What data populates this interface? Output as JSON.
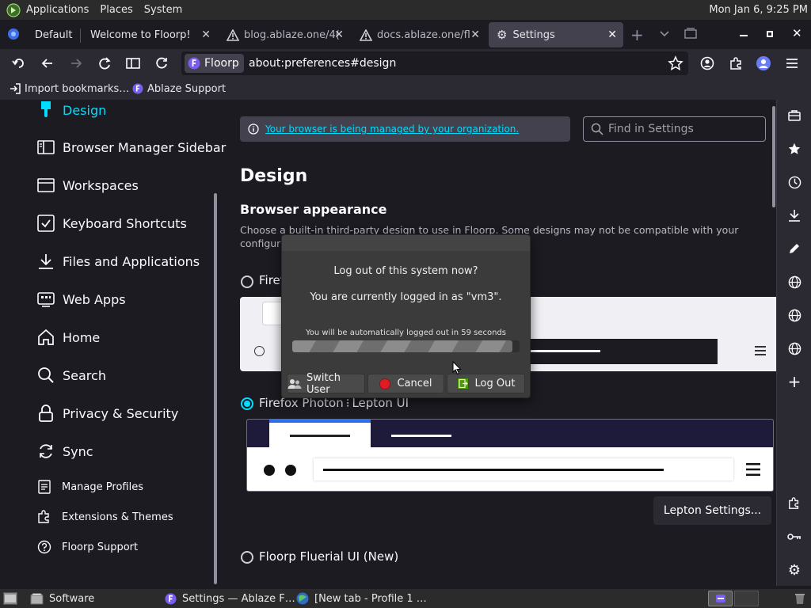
{
  "panel": {
    "menus": [
      "Applications",
      "Places",
      "System"
    ],
    "clock": "Mon Jan  6,  9:25 PM"
  },
  "tabs": {
    "items": [
      {
        "label": "Default"
      },
      {
        "label": "Welcome to Floorp!"
      },
      {
        "label": "blog.ablaze.one/4("
      },
      {
        "label": "docs.ablaze.one/fl"
      },
      {
        "label": "Settings"
      }
    ]
  },
  "navbar": {
    "identity_label": "Floorp",
    "url": "about:preferences#design"
  },
  "bookmarks": {
    "items": [
      {
        "label": "Import bookmarks…"
      },
      {
        "label": "Ablaze Support"
      }
    ]
  },
  "sidebar": {
    "items": [
      {
        "label": "Design",
        "icon": "design-icon",
        "selected": true
      },
      {
        "label": "Browser Manager Sidebar",
        "icon": "sidebar-icon"
      },
      {
        "label": "Workspaces",
        "icon": "workspaces-icon"
      },
      {
        "label": "Keyboard Shortcuts",
        "icon": "keyboard-shortcuts-icon"
      },
      {
        "label": "Files and Applications",
        "icon": "download-icon"
      },
      {
        "label": "Web Apps",
        "icon": "web-apps-icon"
      },
      {
        "label": "Home",
        "icon": "home-icon"
      },
      {
        "label": "Search",
        "icon": "search-icon"
      },
      {
        "label": "Privacy & Security",
        "icon": "lock-icon"
      },
      {
        "label": "Sync",
        "icon": "sync-icon"
      }
    ],
    "footer": [
      {
        "label": "Manage Profiles",
        "icon": "profiles-icon"
      },
      {
        "label": "Extensions & Themes",
        "icon": "puzzle-icon"
      },
      {
        "label": "Floorp Support",
        "icon": "help-icon"
      }
    ]
  },
  "main": {
    "notice": "Your browser is being managed by your organization.",
    "search_placeholder": "Find in Settings",
    "heading": "Design",
    "section_title": "Browser appearance",
    "section_desc_line1": "Choose a built-in third-party design to use in Floorp. Some designs may not be compatible with your",
    "section_desc_line2": "configura",
    "option1_label": "Firef",
    "option2_label": "Firefox Photon ⁝ Lepton UI",
    "lepton_button": "Lepton Settings...",
    "option3_label": "Floorp Fluerial UI (New)"
  },
  "dialog": {
    "title": "Log out of this system now?",
    "subtitle": "You are currently logged in as \"vm3\".",
    "countdown": "You will be automatically logged out in 59 seconds",
    "progress_fraction": 0.97,
    "buttons": {
      "switch_user": "Switch User",
      "cancel": "Cancel",
      "logout": "Log Out"
    }
  },
  "taskbar": {
    "items": [
      {
        "label": "Software"
      },
      {
        "label": "Settings — Ablaze F…"
      },
      {
        "label": "[New tab - Profile 1 …"
      }
    ]
  },
  "colors": {
    "accent": "#00ddff",
    "cancel_red": "#e01b24",
    "logout_green": "#4e9a06"
  }
}
